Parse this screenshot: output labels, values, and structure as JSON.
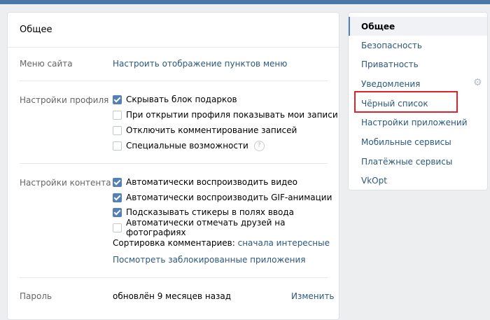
{
  "panel": {
    "title": "Общее",
    "menu_site": {
      "label": "Меню сайта",
      "link": "Настроить отображение пунктов меню"
    },
    "profile": {
      "label": "Настройки профиля",
      "options": [
        {
          "text": "Скрывать блок подарков",
          "checked": true
        },
        {
          "text": "При открытии профиля показывать мои записи",
          "checked": false
        },
        {
          "text": "Отключить комментирование записей",
          "checked": false
        },
        {
          "text": "Специальные возможности",
          "checked": false
        }
      ],
      "help_glyph": "?"
    },
    "content": {
      "label": "Настройки контента",
      "options": [
        {
          "text": "Автоматически воспроизводить видео",
          "checked": true
        },
        {
          "text": "Автоматически воспроизводить GIF-анимации",
          "checked": true
        },
        {
          "text": "Подсказывать стикеры в полях ввода",
          "checked": true
        },
        {
          "text": "Автоматически отмечать друзей на фотографиях",
          "checked": false
        }
      ],
      "sort_label": "Сортировка комментариев:",
      "sort_value": "сначала интересные",
      "blocked_apps": "Посмотреть заблокированные приложения"
    },
    "password": {
      "label": "Пароль",
      "status": "обновлён 9 месяцев назад",
      "change": "Изменить"
    }
  },
  "menu": {
    "items": [
      {
        "label": "Общее"
      },
      {
        "label": "Безопасность"
      },
      {
        "label": "Приватность"
      },
      {
        "label": "Уведомления"
      },
      {
        "label": "Чёрный список"
      },
      {
        "label": "Настройки приложений"
      },
      {
        "label": "Мобильные сервисы"
      },
      {
        "label": "Платёжные сервисы"
      },
      {
        "label": "VkOpt"
      }
    ],
    "gear_icon": "⚙"
  },
  "colors": {
    "accent": "#5181b8",
    "link": "#2a5885",
    "highlight": "#e0202a",
    "topbar": "#4a76a8"
  }
}
